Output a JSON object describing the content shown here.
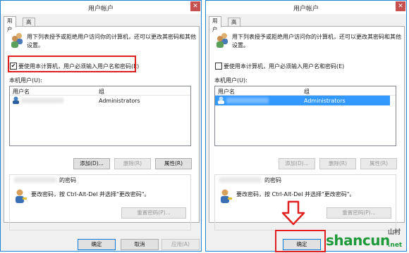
{
  "dialog": {
    "title": "用户帐户",
    "close_glyph": "✕",
    "tabs": [
      "用户",
      "高级"
    ],
    "intro": [
      "用下列表授予或拒绝用户访问你的计算机，还可以更改其密码和其他",
      "设置。"
    ],
    "require_login_label": "要使用本计算机，用户必须输入用户名和密码(E)",
    "users_label": "本机用户(U):",
    "columns": {
      "username": "用户名",
      "group": "组"
    },
    "user_group": "Administrators",
    "buttons": {
      "add": "添加(D)...",
      "remove": "删除(R)",
      "properties": "属性(R)"
    },
    "password_heading": "的密码",
    "password_text": "要改密码，按 Ctrl-Alt-Del 并选择\"更改密码\"。",
    "reset_password": "重置密码(P)...",
    "ok": "确定",
    "cancel": "取消",
    "apply": "应用(A)"
  },
  "left": {
    "require_login_checked": "✔"
  },
  "right": {
    "require_login_checked": ""
  },
  "watermark": {
    "text": "shancun",
    "sub": "山村",
    "net": ".net"
  },
  "colors": {
    "accent": "#1c85d8",
    "selection": "#3399ff",
    "annotation": "#e02020"
  }
}
